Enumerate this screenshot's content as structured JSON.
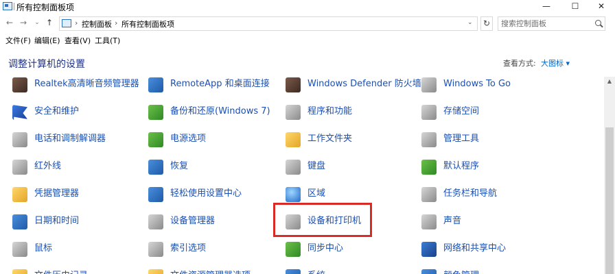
{
  "window": {
    "title": "所有控制面板项",
    "minimize": "—",
    "maximize": "☐",
    "close": "✕"
  },
  "address": {
    "crumbs": [
      "控制面板",
      "所有控制面板项"
    ],
    "back": "←",
    "forward": "→",
    "recent": "⌄",
    "up": "↑",
    "dropdown": "⌄",
    "refresh": "↻",
    "search_placeholder": "搜索控制面板"
  },
  "menu": [
    "文件(F)",
    "编辑(E)",
    "查看(V)",
    "工具(T)"
  ],
  "header": {
    "title": "调整计算机的设置",
    "view_by_label": "查看方式:",
    "view_by_value": "大图标 ▾"
  },
  "items": [
    {
      "label": "Realtek高清晰音频管理器",
      "icon": "speaker-icon",
      "col": 0,
      "row": 0
    },
    {
      "label": "RemoteApp 和桌面连接",
      "icon": "remote-desktop-icon",
      "col": 1,
      "row": 0
    },
    {
      "label": "Windows Defender 防火墙",
      "icon": "firewall-icon",
      "col": 2,
      "row": 0
    },
    {
      "label": "Windows To Go",
      "icon": "usb-drive-icon",
      "col": 3,
      "row": 0
    },
    {
      "label": "安全和维护",
      "icon": "flag-icon",
      "col": 0,
      "row": 1
    },
    {
      "label": "备份和还原(Windows 7)",
      "icon": "backup-icon",
      "col": 1,
      "row": 1
    },
    {
      "label": "程序和功能",
      "icon": "programs-icon",
      "col": 2,
      "row": 1
    },
    {
      "label": "存储空间",
      "icon": "storage-icon",
      "col": 3,
      "row": 1
    },
    {
      "label": "电话和调制解调器",
      "icon": "phone-modem-icon",
      "col": 0,
      "row": 2
    },
    {
      "label": "电源选项",
      "icon": "power-icon",
      "col": 1,
      "row": 2
    },
    {
      "label": "工作文件夹",
      "icon": "work-folder-icon",
      "col": 2,
      "row": 2
    },
    {
      "label": "管理工具",
      "icon": "admin-tools-icon",
      "col": 3,
      "row": 2
    },
    {
      "label": "红外线",
      "icon": "infrared-icon",
      "col": 0,
      "row": 3
    },
    {
      "label": "恢复",
      "icon": "recovery-icon",
      "col": 1,
      "row": 3
    },
    {
      "label": "键盘",
      "icon": "keyboard-icon",
      "col": 2,
      "row": 3
    },
    {
      "label": "默认程序",
      "icon": "default-programs-icon",
      "col": 3,
      "row": 3
    },
    {
      "label": "凭据管理器",
      "icon": "credential-icon",
      "col": 0,
      "row": 4
    },
    {
      "label": "轻松使用设置中心",
      "icon": "ease-of-access-icon",
      "col": 1,
      "row": 4
    },
    {
      "label": "区域",
      "icon": "globe-icon",
      "col": 2,
      "row": 4
    },
    {
      "label": "任务栏和导航",
      "icon": "taskbar-icon",
      "col": 3,
      "row": 4
    },
    {
      "label": "日期和时间",
      "icon": "calendar-icon",
      "col": 0,
      "row": 5
    },
    {
      "label": "设备管理器",
      "icon": "device-manager-icon",
      "col": 1,
      "row": 5
    },
    {
      "label": "设备和打印机",
      "icon": "printer-icon",
      "col": 2,
      "row": 5
    },
    {
      "label": "声音",
      "icon": "sound-icon",
      "col": 3,
      "row": 5
    },
    {
      "label": "鼠标",
      "icon": "mouse-icon",
      "col": 0,
      "row": 6
    },
    {
      "label": "索引选项",
      "icon": "index-icon",
      "col": 1,
      "row": 6
    },
    {
      "label": "同步中心",
      "icon": "sync-icon",
      "col": 2,
      "row": 6
    },
    {
      "label": "网络和共享中心",
      "icon": "network-icon",
      "col": 3,
      "row": 6
    },
    {
      "label": "文件历史记录",
      "icon": "file-history-icon",
      "col": 0,
      "row": 7
    },
    {
      "label": "文件资源管理器选项",
      "icon": "explorer-options-icon",
      "col": 1,
      "row": 7
    },
    {
      "label": "系统",
      "icon": "system-icon",
      "col": 2,
      "row": 7
    },
    {
      "label": "颜色管理",
      "icon": "color-icon",
      "col": 3,
      "row": 7
    }
  ],
  "highlighted_item": "设备和打印机",
  "colors": {
    "link": "#1a4fb3",
    "heading": "#1e3287",
    "highlight": "#d92a25"
  }
}
